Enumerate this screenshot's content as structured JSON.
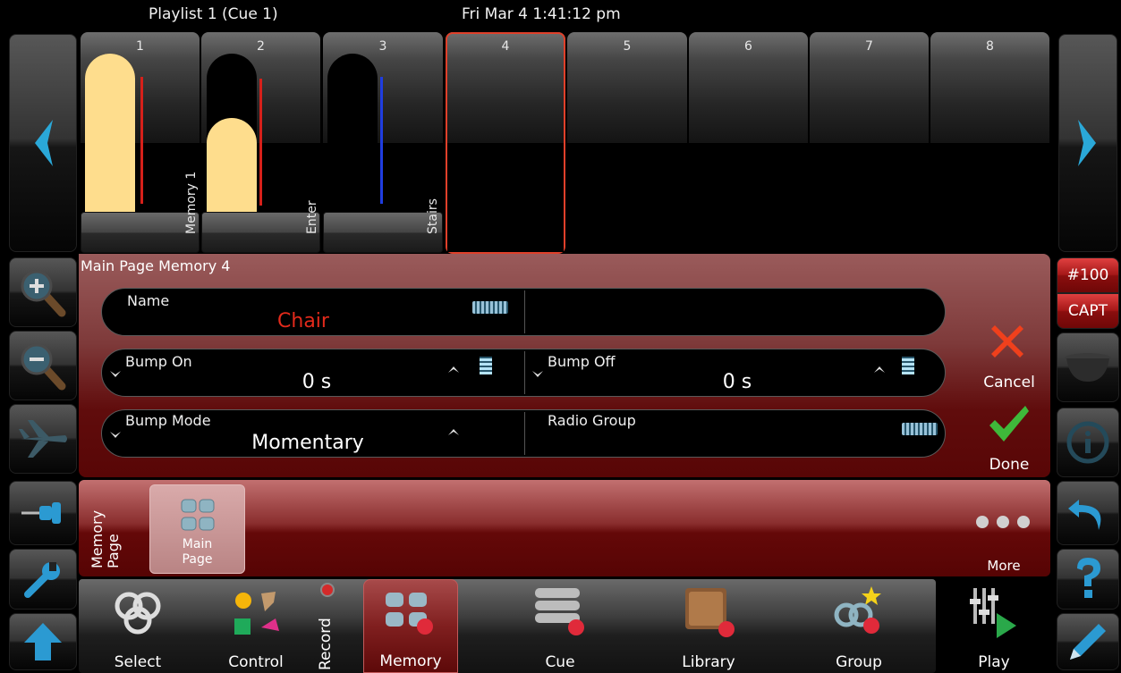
{
  "status": {
    "playlist": "Playlist 1 (Cue 1)",
    "datetime": "Fri Mar 4 1:41:12 pm"
  },
  "channels": [
    {
      "num": "1",
      "label": "Memory 1"
    },
    {
      "num": "2",
      "label": "Enter"
    },
    {
      "num": "3",
      "label": "Stairs"
    },
    {
      "num": "4",
      "label": ""
    },
    {
      "num": "5",
      "label": ""
    },
    {
      "num": "6",
      "label": ""
    },
    {
      "num": "7",
      "label": ""
    },
    {
      "num": "8",
      "label": ""
    }
  ],
  "fader_levels": [
    1.0,
    0.6,
    0.0
  ],
  "panel": {
    "title": "Main Page Memory 4",
    "name_label": "Name",
    "name_value": "Chair",
    "bump_on_label": "Bump On",
    "bump_on_value": "0 s",
    "bump_off_label": "Bump Off",
    "bump_off_value": "0 s",
    "bump_mode_label": "Bump Mode",
    "bump_mode_value": "Momentary",
    "radio_group_label": "Radio Group",
    "cancel_label": "Cancel",
    "done_label": "Done"
  },
  "right_sidebar": {
    "number": "#100",
    "capture": "CAPT"
  },
  "page_strip": {
    "section_label_1": "Memory",
    "section_label_2": "Page",
    "tile_label_1": "Main",
    "tile_label_2": "Page",
    "more_label": "More"
  },
  "bottom_tabs": {
    "select": "Select",
    "control": "Control",
    "record": "Record",
    "memory": "Memory",
    "cue": "Cue",
    "library": "Library",
    "group": "Group",
    "play": "Play"
  },
  "colors": {
    "accent_red": "#e32a1b",
    "fader_fill": "#fedd8d",
    "check_green": "#3fb83a",
    "icon_blue": "#2a9fd8"
  }
}
